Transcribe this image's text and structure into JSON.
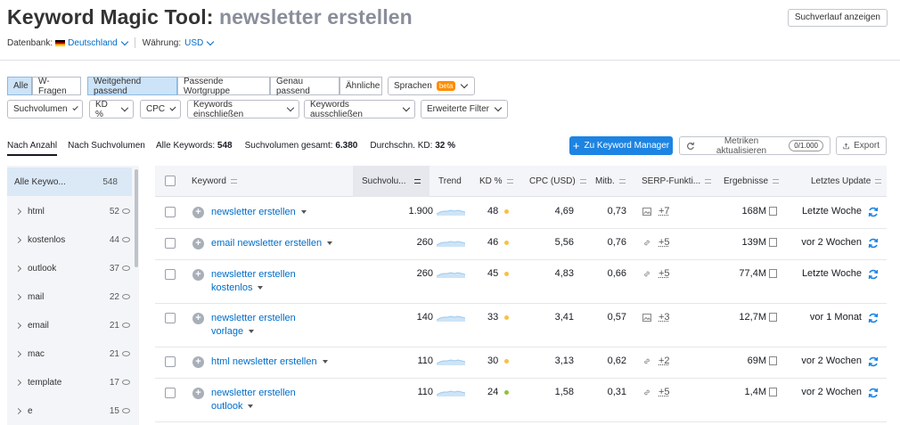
{
  "header": {
    "title": "Keyword Magic Tool:",
    "query": "newsletter erstellen",
    "history_button": "Suchverlauf anzeigen",
    "database_label": "Datenbank:",
    "database_value": "Deutschland",
    "currency_label": "Währung:",
    "currency_value": "USD"
  },
  "filters": {
    "match": [
      "Alle",
      "W-Fragen"
    ],
    "match_type": [
      "Weitgehend passend",
      "Passende Wortgruppe",
      "Genau passend",
      "Ähnliche"
    ],
    "languages": "Sprachen",
    "beta": "beta",
    "dropdowns": [
      "Suchvolumen",
      "KD %",
      "CPC",
      "Keywords einschließen",
      "Keywords ausschließen",
      "Erweiterte Filter"
    ]
  },
  "group_tabs": [
    "Nach Anzahl",
    "Nach Suchvolumen"
  ],
  "stats": {
    "all_label": "Alle Keywords:",
    "all_value": "548",
    "volume_label": "Suchvolumen gesamt:",
    "volume_value": "6.380",
    "kd_label": "Durchschn. KD:",
    "kd_value": "32 %"
  },
  "actions": {
    "add": "Zu Keyword Manager",
    "refresh": "Metriken aktualisieren",
    "refresh_count": "0/1.000",
    "export": "Export"
  },
  "sidebar": {
    "items": [
      {
        "label": "Alle Keywo...",
        "count": "548"
      },
      {
        "label": "html",
        "count": "52"
      },
      {
        "label": "kostenlos",
        "count": "44"
      },
      {
        "label": "outlook",
        "count": "37"
      },
      {
        "label": "mail",
        "count": "22"
      },
      {
        "label": "email",
        "count": "21"
      },
      {
        "label": "mac",
        "count": "21"
      },
      {
        "label": "template",
        "count": "17"
      },
      {
        "label": "e",
        "count": "15"
      }
    ]
  },
  "table": {
    "columns": [
      "Keyword",
      "Suchvolu...",
      "Trend",
      "KD %",
      "CPC (USD)",
      "Mitb.",
      "SERP-Funkti...",
      "Ergebnisse",
      "Letztes Update"
    ],
    "rows": [
      {
        "kw1": "newsletter erstellen",
        "kw2": "",
        "volume": "1.900",
        "kd": "48",
        "kd_color": "#f5c242",
        "cpc": "4,69",
        "comp": "0,73",
        "serp_icon": "image",
        "serp": "+7",
        "results": "168M",
        "update": "Letzte Woche"
      },
      {
        "kw1": "email newsletter erstellen",
        "kw2": "",
        "volume": "260",
        "kd": "46",
        "kd_color": "#f5c242",
        "cpc": "5,56",
        "comp": "0,76",
        "serp_icon": "link",
        "serp": "+5",
        "results": "139M",
        "update": "vor 2 Wochen"
      },
      {
        "kw1": "newsletter erstellen",
        "kw2": "kostenlos",
        "volume": "260",
        "kd": "45",
        "kd_color": "#f5c242",
        "cpc": "4,83",
        "comp": "0,66",
        "serp_icon": "link",
        "serp": "+5",
        "results": "77,4M",
        "update": "Letzte Woche"
      },
      {
        "kw1": "newsletter erstellen",
        "kw2": "vorlage",
        "volume": "140",
        "kd": "33",
        "kd_color": "#f5c242",
        "cpc": "3,41",
        "comp": "0,57",
        "serp_icon": "image",
        "serp": "+3",
        "results": "12,7M",
        "update": "vor 1 Monat"
      },
      {
        "kw1": "html newsletter erstellen",
        "kw2": "",
        "volume": "110",
        "kd": "30",
        "kd_color": "#f5c242",
        "cpc": "3,13",
        "comp": "0,62",
        "serp_icon": "link",
        "serp": "+2",
        "results": "69M",
        "update": "vor 2 Wochen"
      },
      {
        "kw1": "newsletter erstellen",
        "kw2": "outlook",
        "volume": "110",
        "kd": "24",
        "kd_color": "#8fc33b",
        "cpc": "1,58",
        "comp": "0,31",
        "serp_icon": "link",
        "serp": "+5",
        "results": "1,4M",
        "update": "vor 2 Wochen"
      }
    ]
  }
}
